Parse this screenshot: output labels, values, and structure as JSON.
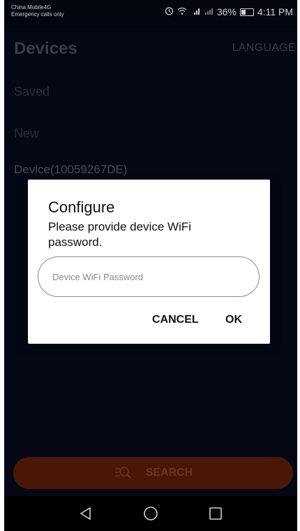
{
  "status_bar": {
    "carrier": "China Mobile4G",
    "carrier_sub": "Emergency calls only",
    "icons": [
      "alarm-icon",
      "wifi-icon",
      "4g-signal-icon",
      "signal-icon"
    ],
    "battery": "36%",
    "time": "4:11 PM"
  },
  "app_bar": {
    "title": "Devices",
    "language_label": "LANGUAGE"
  },
  "list": {
    "saved_label": "Saved",
    "new_label": "New",
    "device_name": "Device(10059267DE)"
  },
  "search": {
    "label": "SEARCH",
    "icon": "search-list-icon"
  },
  "nav": {
    "back": "back-triangle-icon",
    "home": "home-circle-icon",
    "recents": "recents-square-icon"
  },
  "dialog": {
    "title": "Configure",
    "message": "Please provide device WiFi password.",
    "input_placeholder": "Device WiFi Password",
    "input_value": "",
    "cancel_label": "CANCEL",
    "ok_label": "OK"
  },
  "colors": {
    "background": "#050714",
    "search_bar": "#4a1707",
    "dialog_bg": "#ffffff"
  }
}
